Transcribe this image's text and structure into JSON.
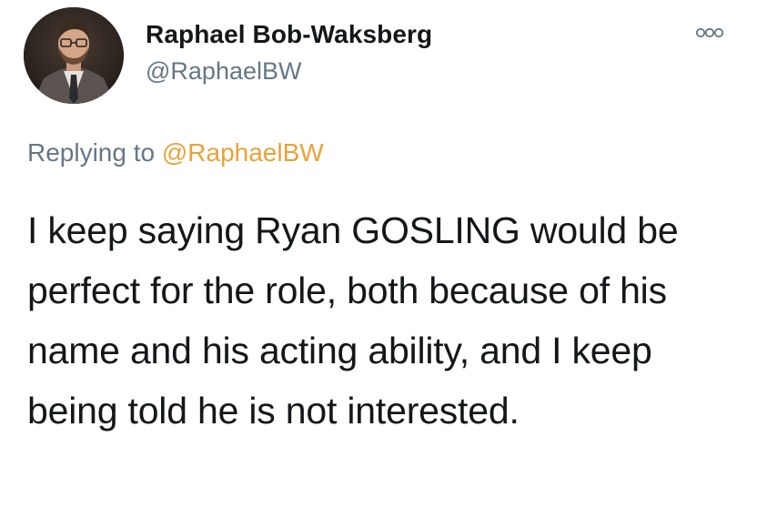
{
  "author": {
    "display_name": "Raphael Bob-Waksberg",
    "handle": "@RaphaelBW",
    "avatar_icon": "profile-photo"
  },
  "more_icon": "more-options-icon",
  "reply": {
    "prefix": "Replying to ",
    "mention": "@RaphaelBW"
  },
  "tweet": {
    "text": "I keep saying Ryan GOSLING would be perfect for the role, both because of his name and his acting ability, and I keep being told he is not interested."
  },
  "colors": {
    "text": "#14171a",
    "secondary": "#657786",
    "mention": "#e8a33a"
  }
}
